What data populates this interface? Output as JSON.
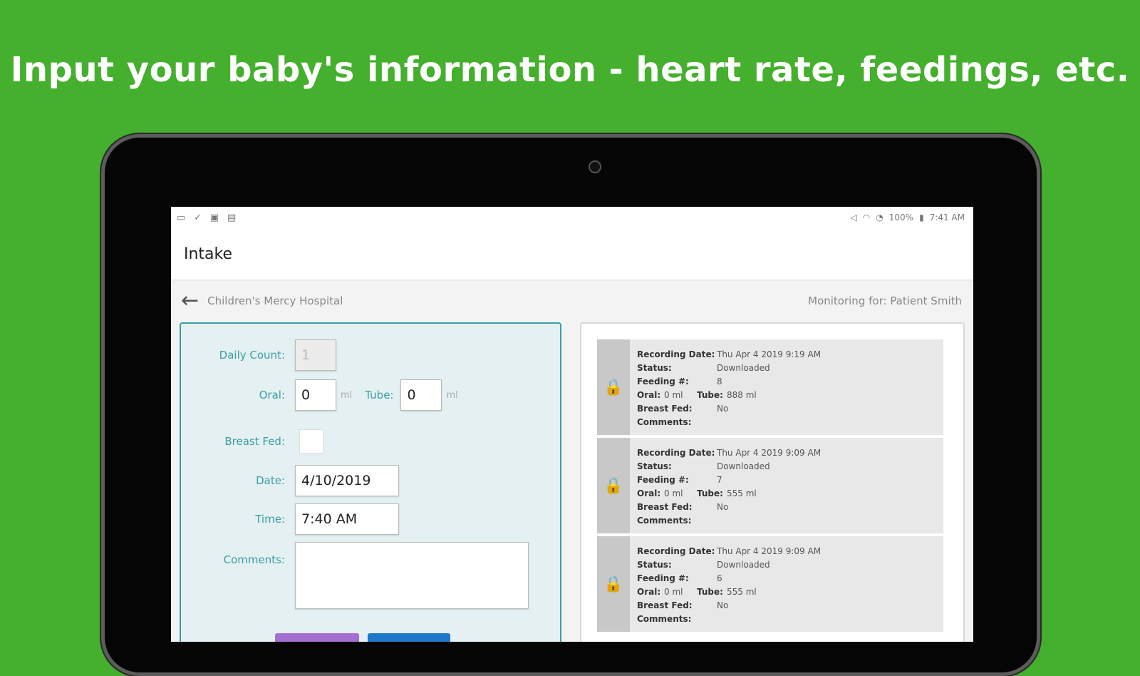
{
  "headline": "Input your baby's information - heart rate, feedings, etc.",
  "status_bar": {
    "left_icons": [
      "image-icon",
      "check-icon",
      "gallery-icon",
      "calendar-icon"
    ],
    "battery": "100%",
    "time": "7:41 AM"
  },
  "appbar": {
    "title": "Intake"
  },
  "subnav": {
    "hospital": "Children's Mercy Hospital",
    "monitoring_label": "Monitoring for:",
    "patient": "Patient Smith"
  },
  "form": {
    "daily_count_label": "Daily Count:",
    "daily_count_value": "1",
    "oral_label": "Oral:",
    "oral_value": "0",
    "oral_unit": "ml",
    "tube_label": "Tube:",
    "tube_value": "0",
    "tube_unit": "ml",
    "breast_fed_label": "Breast Fed:",
    "date_label": "Date:",
    "date_value": "4/10/2019",
    "time_label": "Time:",
    "time_value": "7:40 AM",
    "comments_label": "Comments:",
    "comments_value": ""
  },
  "records": [
    {
      "recording_date_label": "Recording Date:",
      "recording_date": "Thu Apr 4 2019 9:19 AM",
      "status_label": "Status:",
      "status": "Downloaded",
      "feeding_label": "Feeding #:",
      "feeding": "8",
      "oral_label": "Oral:",
      "oral": "0 ml",
      "tube_label": "Tube:",
      "tube": "888 ml",
      "breast_fed_label": "Breast Fed:",
      "breast_fed": "No",
      "comments_label": "Comments:"
    },
    {
      "recording_date_label": "Recording Date:",
      "recording_date": "Thu Apr 4 2019 9:09 AM",
      "status_label": "Status:",
      "status": "Downloaded",
      "feeding_label": "Feeding #:",
      "feeding": "7",
      "oral_label": "Oral:",
      "oral": "0 ml",
      "tube_label": "Tube:",
      "tube": "555 ml",
      "breast_fed_label": "Breast Fed:",
      "breast_fed": "No",
      "comments_label": "Comments:"
    },
    {
      "recording_date_label": "Recording Date:",
      "recording_date": "Thu Apr 4 2019 9:09 AM",
      "status_label": "Status:",
      "status": "Downloaded",
      "feeding_label": "Feeding #:",
      "feeding": "6",
      "oral_label": "Oral:",
      "oral": "0 ml",
      "tube_label": "Tube:",
      "tube": "555 ml",
      "breast_fed_label": "Breast Fed:",
      "breast_fed": "No",
      "comments_label": "Comments:"
    }
  ],
  "colors": {
    "background": "#44b02d",
    "accent": "#3a9ea5",
    "clear_button": "#a56fd1",
    "save_button": "#1f78c8"
  }
}
